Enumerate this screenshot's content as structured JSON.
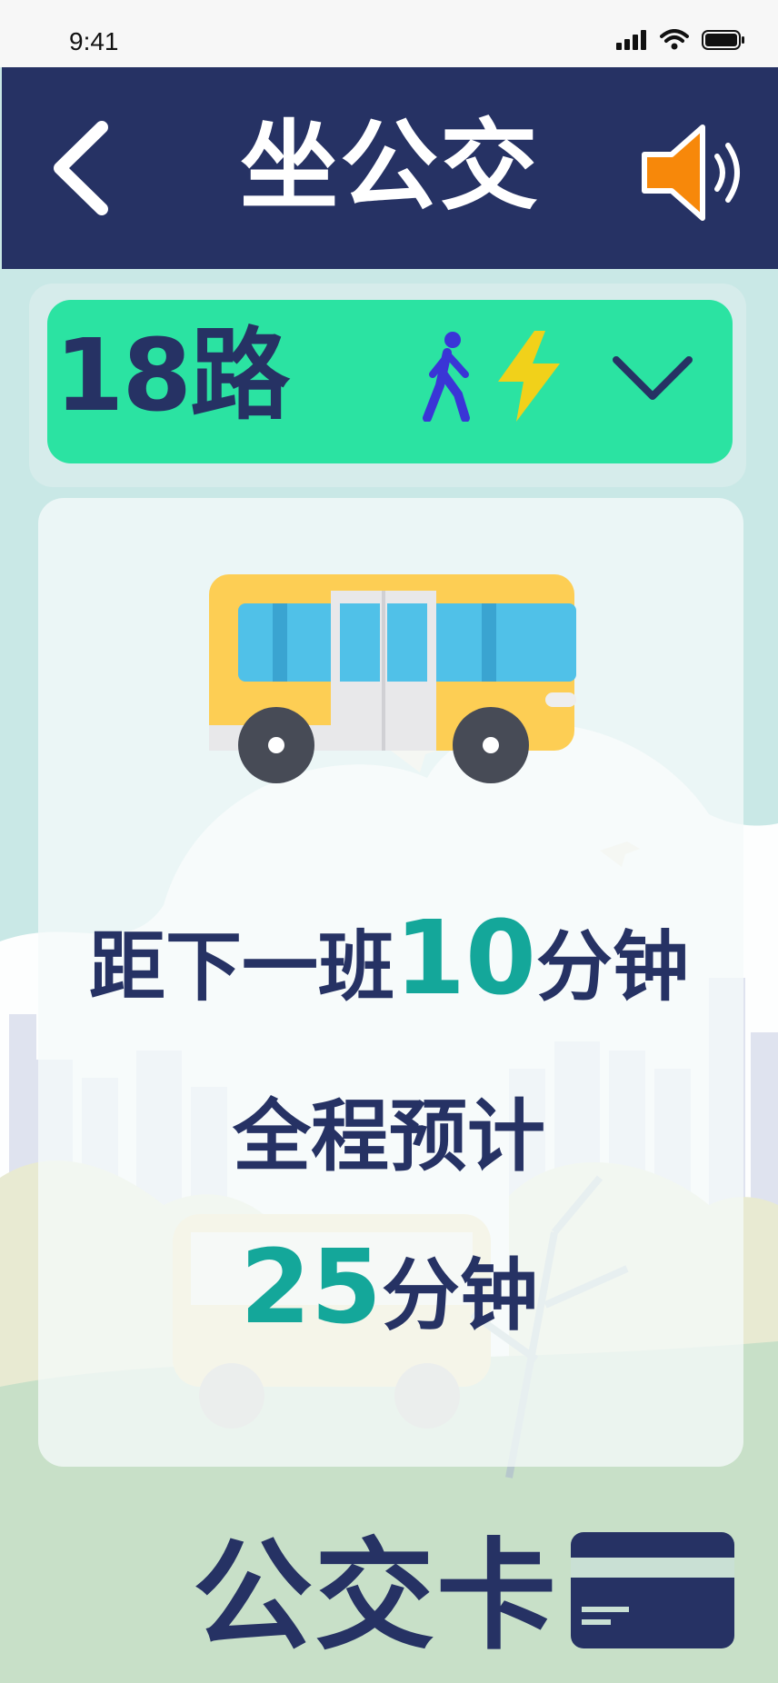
{
  "status_bar": {
    "time": "9:41"
  },
  "header": {
    "title": "坐公交"
  },
  "route": {
    "label": "18路"
  },
  "info": {
    "next_prefix": "距下一班",
    "next_minutes": "10",
    "next_suffix": "分钟",
    "total_label": "全程预计",
    "total_minutes": "25",
    "total_suffix": "分钟"
  },
  "bus_card": {
    "label": "公交卡"
  },
  "colors": {
    "header_bg": "#263264",
    "route_bar": "#2be3a2",
    "accent_number": "#14a79a",
    "text_dark": "#263264",
    "speaker": "#f7880a",
    "bolt": "#f1d11a",
    "walker": "#3a35d6"
  },
  "icons": [
    "back-chevron-icon",
    "speaker-icon",
    "walk-icon",
    "lightning-icon",
    "chevron-down-icon",
    "bus-icon",
    "card-icon"
  ]
}
